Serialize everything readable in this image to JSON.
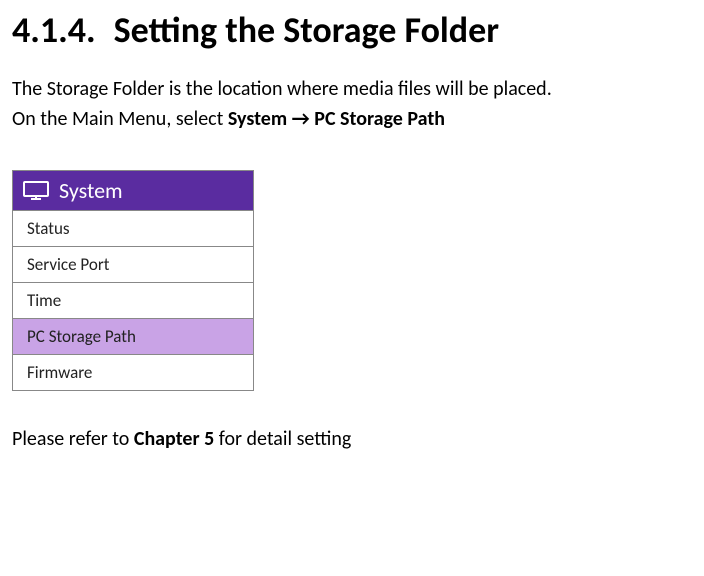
{
  "heading": {
    "number": "4.1.4.",
    "title": "Setting the Storage Folder"
  },
  "intro": {
    "line1": "The Storage Folder is the location where media files will be placed.",
    "line2_pre": "On the Main Menu, select ",
    "nav_system": "System",
    "nav_arrow": "→",
    "nav_target": "PC Storage Path"
  },
  "menu": {
    "header": "System",
    "items": [
      {
        "label": "Status",
        "selected": false
      },
      {
        "label": "Service Port",
        "selected": false
      },
      {
        "label": "Time",
        "selected": false
      },
      {
        "label": "PC Storage Path",
        "selected": true
      },
      {
        "label": "Firmware",
        "selected": false
      }
    ]
  },
  "footer": {
    "pre": "Please refer to ",
    "chapter": "Chapter 5",
    "post": " for detail setting"
  }
}
